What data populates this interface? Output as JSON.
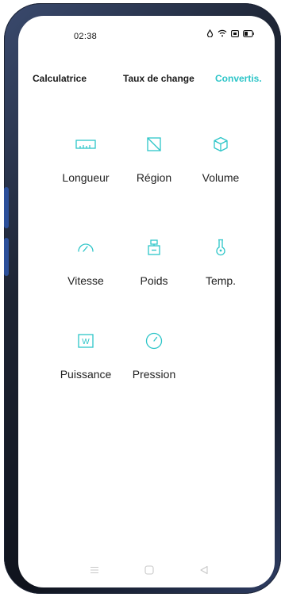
{
  "status_bar": {
    "time": "02:38",
    "icons": [
      "data-saver-icon",
      "wifi-icon",
      "sim-icon",
      "battery-icon"
    ]
  },
  "tabs": [
    {
      "label": "Calculatrice",
      "active": false
    },
    {
      "label": "Taux de change",
      "active": false
    },
    {
      "label": "Convertis.",
      "active": true
    }
  ],
  "converters": [
    {
      "label": "Longueur",
      "icon": "ruler-icon"
    },
    {
      "label": "Région",
      "icon": "area-icon"
    },
    {
      "label": "Volume",
      "icon": "cube-icon"
    },
    {
      "label": "Vitesse",
      "icon": "speedometer-icon"
    },
    {
      "label": "Poids",
      "icon": "scale-icon"
    },
    {
      "label": "Temp.",
      "icon": "thermometer-icon"
    },
    {
      "label": "Puissance",
      "icon": "power-icon"
    },
    {
      "label": "Pression",
      "icon": "pressure-gauge-icon"
    }
  ],
  "nav_bar": {
    "buttons": [
      "menu-icon",
      "home-icon",
      "back-icon"
    ]
  },
  "colors": {
    "accent": "#2dc5c8",
    "text": "#222222",
    "frame": "#1d2433"
  }
}
